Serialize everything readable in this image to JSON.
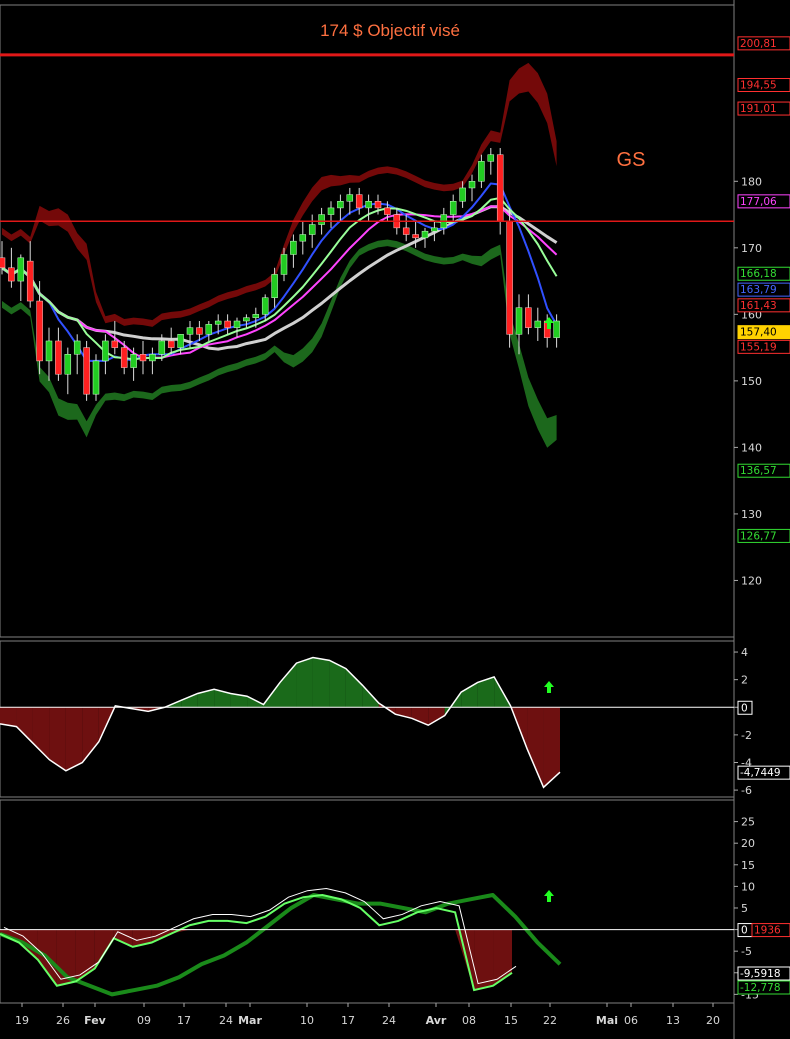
{
  "chart_data": {
    "type": "candlestick",
    "ticker": "GS",
    "annotation": "174 $ Objectif visé",
    "price_panel": {
      "ylim": [
        111.5,
        206.5
      ],
      "yticks": [
        120,
        130,
        140,
        150,
        160,
        170,
        180
      ],
      "horizontal_levels": [
        174,
        199
      ],
      "candles": [
        {
          "o": 168.5,
          "h": 171,
          "l": 166,
          "c": 167
        },
        {
          "o": 167,
          "h": 170,
          "l": 164,
          "c": 165
        },
        {
          "o": 165,
          "h": 169,
          "l": 162,
          "c": 168.5
        },
        {
          "o": 168,
          "h": 171,
          "l": 161,
          "c": 162
        },
        {
          "o": 162,
          "h": 165,
          "l": 151,
          "c": 153
        },
        {
          "o": 153,
          "h": 158,
          "l": 150,
          "c": 156
        },
        {
          "o": 156,
          "h": 158,
          "l": 150,
          "c": 151
        },
        {
          "o": 151,
          "h": 155,
          "l": 148,
          "c": 154
        },
        {
          "o": 154,
          "h": 157,
          "l": 151,
          "c": 156
        },
        {
          "o": 155,
          "h": 156,
          "l": 147,
          "c": 148
        },
        {
          "o": 148,
          "h": 154,
          "l": 147,
          "c": 153
        },
        {
          "o": 153,
          "h": 157,
          "l": 151,
          "c": 156
        },
        {
          "o": 156,
          "h": 159,
          "l": 154,
          "c": 155
        },
        {
          "o": 155,
          "h": 156,
          "l": 151,
          "c": 152
        },
        {
          "o": 152,
          "h": 155,
          "l": 150,
          "c": 154
        },
        {
          "o": 154,
          "h": 156,
          "l": 151,
          "c": 153
        },
        {
          "o": 153,
          "h": 155,
          "l": 151,
          "c": 154
        },
        {
          "o": 154,
          "h": 157,
          "l": 153,
          "c": 156
        },
        {
          "o": 156,
          "h": 158,
          "l": 154,
          "c": 155
        },
        {
          "o": 155,
          "h": 157,
          "l": 154,
          "c": 157
        },
        {
          "o": 157,
          "h": 159,
          "l": 155,
          "c": 158
        },
        {
          "o": 158,
          "h": 159,
          "l": 156,
          "c": 157
        },
        {
          "o": 157,
          "h": 159,
          "l": 156,
          "c": 158.5
        },
        {
          "o": 158.5,
          "h": 160,
          "l": 157,
          "c": 159
        },
        {
          "o": 159,
          "h": 160,
          "l": 157,
          "c": 158
        },
        {
          "o": 158,
          "h": 159.5,
          "l": 156.5,
          "c": 159
        },
        {
          "o": 159,
          "h": 160,
          "l": 158,
          "c": 159.5
        },
        {
          "o": 159.5,
          "h": 161,
          "l": 158,
          "c": 160
        },
        {
          "o": 160,
          "h": 163,
          "l": 159,
          "c": 162.5
        },
        {
          "o": 162.5,
          "h": 167,
          "l": 161,
          "c": 166
        },
        {
          "o": 166,
          "h": 170,
          "l": 165,
          "c": 169
        },
        {
          "o": 169,
          "h": 172,
          "l": 167,
          "c": 171
        },
        {
          "o": 171,
          "h": 174,
          "l": 169,
          "c": 172
        },
        {
          "o": 172,
          "h": 175,
          "l": 170,
          "c": 173.5
        },
        {
          "o": 173.5,
          "h": 176,
          "l": 172,
          "c": 175
        },
        {
          "o": 175,
          "h": 177,
          "l": 173,
          "c": 176
        },
        {
          "o": 176,
          "h": 178,
          "l": 174,
          "c": 177
        },
        {
          "o": 177,
          "h": 179,
          "l": 175,
          "c": 178
        },
        {
          "o": 178,
          "h": 179,
          "l": 175,
          "c": 176
        },
        {
          "o": 176,
          "h": 178,
          "l": 174,
          "c": 177
        },
        {
          "o": 177,
          "h": 178,
          "l": 175,
          "c": 176
        },
        {
          "o": 176,
          "h": 177,
          "l": 174,
          "c": 175
        },
        {
          "o": 175,
          "h": 176,
          "l": 172,
          "c": 173
        },
        {
          "o": 173,
          "h": 175,
          "l": 171,
          "c": 172
        },
        {
          "o": 172,
          "h": 174,
          "l": 170,
          "c": 171.5
        },
        {
          "o": 171.5,
          "h": 173,
          "l": 170,
          "c": 172.5
        },
        {
          "o": 172.5,
          "h": 174,
          "l": 171,
          "c": 173
        },
        {
          "o": 173,
          "h": 176,
          "l": 172,
          "c": 175
        },
        {
          "o": 175,
          "h": 178,
          "l": 174,
          "c": 177
        },
        {
          "o": 177,
          "h": 180,
          "l": 176,
          "c": 179
        },
        {
          "o": 179,
          "h": 181,
          "l": 177,
          "c": 180
        },
        {
          "o": 180,
          "h": 184,
          "l": 179,
          "c": 183
        },
        {
          "o": 183,
          "h": 185,
          "l": 181,
          "c": 184
        },
        {
          "o": 184,
          "h": 185,
          "l": 172,
          "c": 174
        },
        {
          "o": 174,
          "h": 176,
          "l": 155,
          "c": 157
        },
        {
          "o": 157,
          "h": 163,
          "l": 154,
          "c": 161
        },
        {
          "o": 161,
          "h": 163,
          "l": 157,
          "c": 158
        },
        {
          "o": 158,
          "h": 161,
          "l": 156,
          "c": 159
        },
        {
          "o": 159,
          "h": 160,
          "l": 155,
          "c": 156.5
        },
        {
          "o": 156.5,
          "h": 160,
          "l": 155,
          "c": 159
        }
      ],
      "price_tags": [
        {
          "label": "200,81",
          "value": 200.81,
          "color": "#ff3030"
        },
        {
          "label": "194,55",
          "value": 194.55,
          "color": "#ff3030"
        },
        {
          "label": "191,01",
          "value": 191.01,
          "color": "#ff3030"
        },
        {
          "label": "177,06",
          "value": 177.06,
          "color": "#ff44ff"
        },
        {
          "label": "166,18",
          "value": 166.18,
          "color": "#33dd33"
        },
        {
          "label": "163,79",
          "value": 163.79,
          "color": "#4466ff"
        },
        {
          "label": "161,43",
          "value": 161.43,
          "color": "#ff3030"
        },
        {
          "label": "157,40",
          "value": 157.4,
          "color": "#ffd200"
        },
        {
          "label": "155,19",
          "value": 155.19,
          "color": "#ff3030"
        },
        {
          "label": "136,57",
          "value": 136.57,
          "color": "#33dd33"
        },
        {
          "label": "126,77",
          "value": 126.77,
          "color": "#33dd33"
        }
      ]
    },
    "oscillator_panel": {
      "ylim": [
        -6.5,
        4.8
      ],
      "yticks": [
        4,
        2,
        0,
        -2,
        -4,
        -6
      ],
      "tick_labels": [
        "4",
        "2",
        "0",
        "-2",
        "-4",
        "-6"
      ],
      "zero_label": "0",
      "last_value_label": "-4,7449",
      "values": [
        -1.2,
        -1.4,
        -2.6,
        -3.8,
        -4.6,
        -4.0,
        -2.5,
        0.1,
        -0.1,
        -0.3,
        0.0,
        0.5,
        1.0,
        1.3,
        1.0,
        0.8,
        0.2,
        1.8,
        3.2,
        3.6,
        3.4,
        2.8,
        1.6,
        0.3,
        -0.5,
        -0.8,
        -1.3,
        -0.6,
        1.1,
        1.8,
        2.2,
        0.1,
        -3.0,
        -5.8,
        -4.7
      ]
    },
    "stochastic_panel": {
      "ylim": [
        -17,
        30
      ],
      "yticks": [
        25,
        20,
        15,
        10,
        5,
        0,
        -5,
        -10,
        -15
      ],
      "tick_labels": [
        "25",
        "20",
        "15",
        "10",
        "5",
        "0",
        "-5",
        "-10",
        "-15"
      ],
      "zero_label": "0",
      "tag_label": "1936",
      "last_value_labels": [
        "-9,5918",
        "-12,778"
      ],
      "fast_line": [
        -1,
        -3,
        -7,
        -13,
        -12,
        -9,
        -2,
        -4,
        -3,
        -1,
        1,
        2,
        2,
        1.5,
        3,
        6,
        7.5,
        8,
        7,
        5,
        1,
        2,
        4,
        5,
        4,
        -14,
        -13,
        -10
      ],
      "slow_line": [
        -1,
        -3,
        -6,
        -11,
        -13,
        -15,
        -14,
        -13,
        -11,
        -8,
        -6,
        -3,
        1,
        5,
        8,
        7,
        6,
        6,
        5,
        4,
        6,
        7,
        8,
        3,
        -3,
        -8
      ]
    },
    "x_tick_labels": [
      "19",
      "26",
      "Fev",
      "09",
      "17",
      "24",
      "Mar",
      "10",
      "17",
      "24",
      "Avr",
      "08",
      "15",
      "22",
      "Mai",
      "06",
      "13",
      "20"
    ]
  }
}
